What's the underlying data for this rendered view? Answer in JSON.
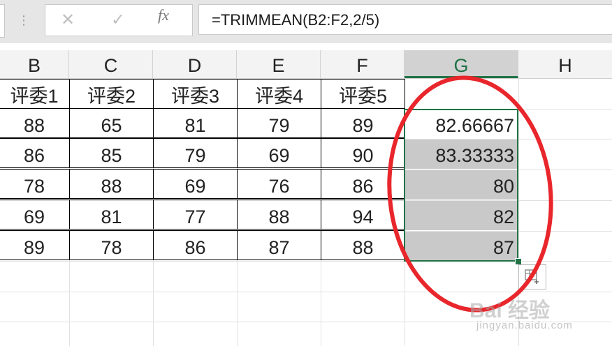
{
  "formula_bar": {
    "cancel_glyph": "✕",
    "enter_glyph": "✓",
    "fx_label": "fx",
    "formula": "=TRIMMEAN(B2:F2,2/5)"
  },
  "columns": [
    "B",
    "C",
    "D",
    "E",
    "F",
    "G",
    "H"
  ],
  "header_row": [
    "评委1",
    "评委2",
    "评委3",
    "评委4",
    "评委5"
  ],
  "rows": [
    {
      "scores": [
        "88",
        "65",
        "81",
        "79",
        "89"
      ],
      "result": "82.66667"
    },
    {
      "scores": [
        "86",
        "85",
        "79",
        "69",
        "90"
      ],
      "result": "83.33333"
    },
    {
      "scores": [
        "78",
        "88",
        "69",
        "76",
        "86"
      ],
      "result": "80"
    },
    {
      "scores": [
        "69",
        "81",
        "77",
        "88",
        "94"
      ],
      "result": "82"
    },
    {
      "scores": [
        "89",
        "78",
        "86",
        "87",
        "88"
      ],
      "result": "87"
    }
  ],
  "colors": {
    "selection": "#217346",
    "annotation": "#e8262b",
    "shade": "#c9c9c9"
  },
  "watermark": {
    "brand": "Bai 经验",
    "url": "jingyan.baidu.com"
  }
}
